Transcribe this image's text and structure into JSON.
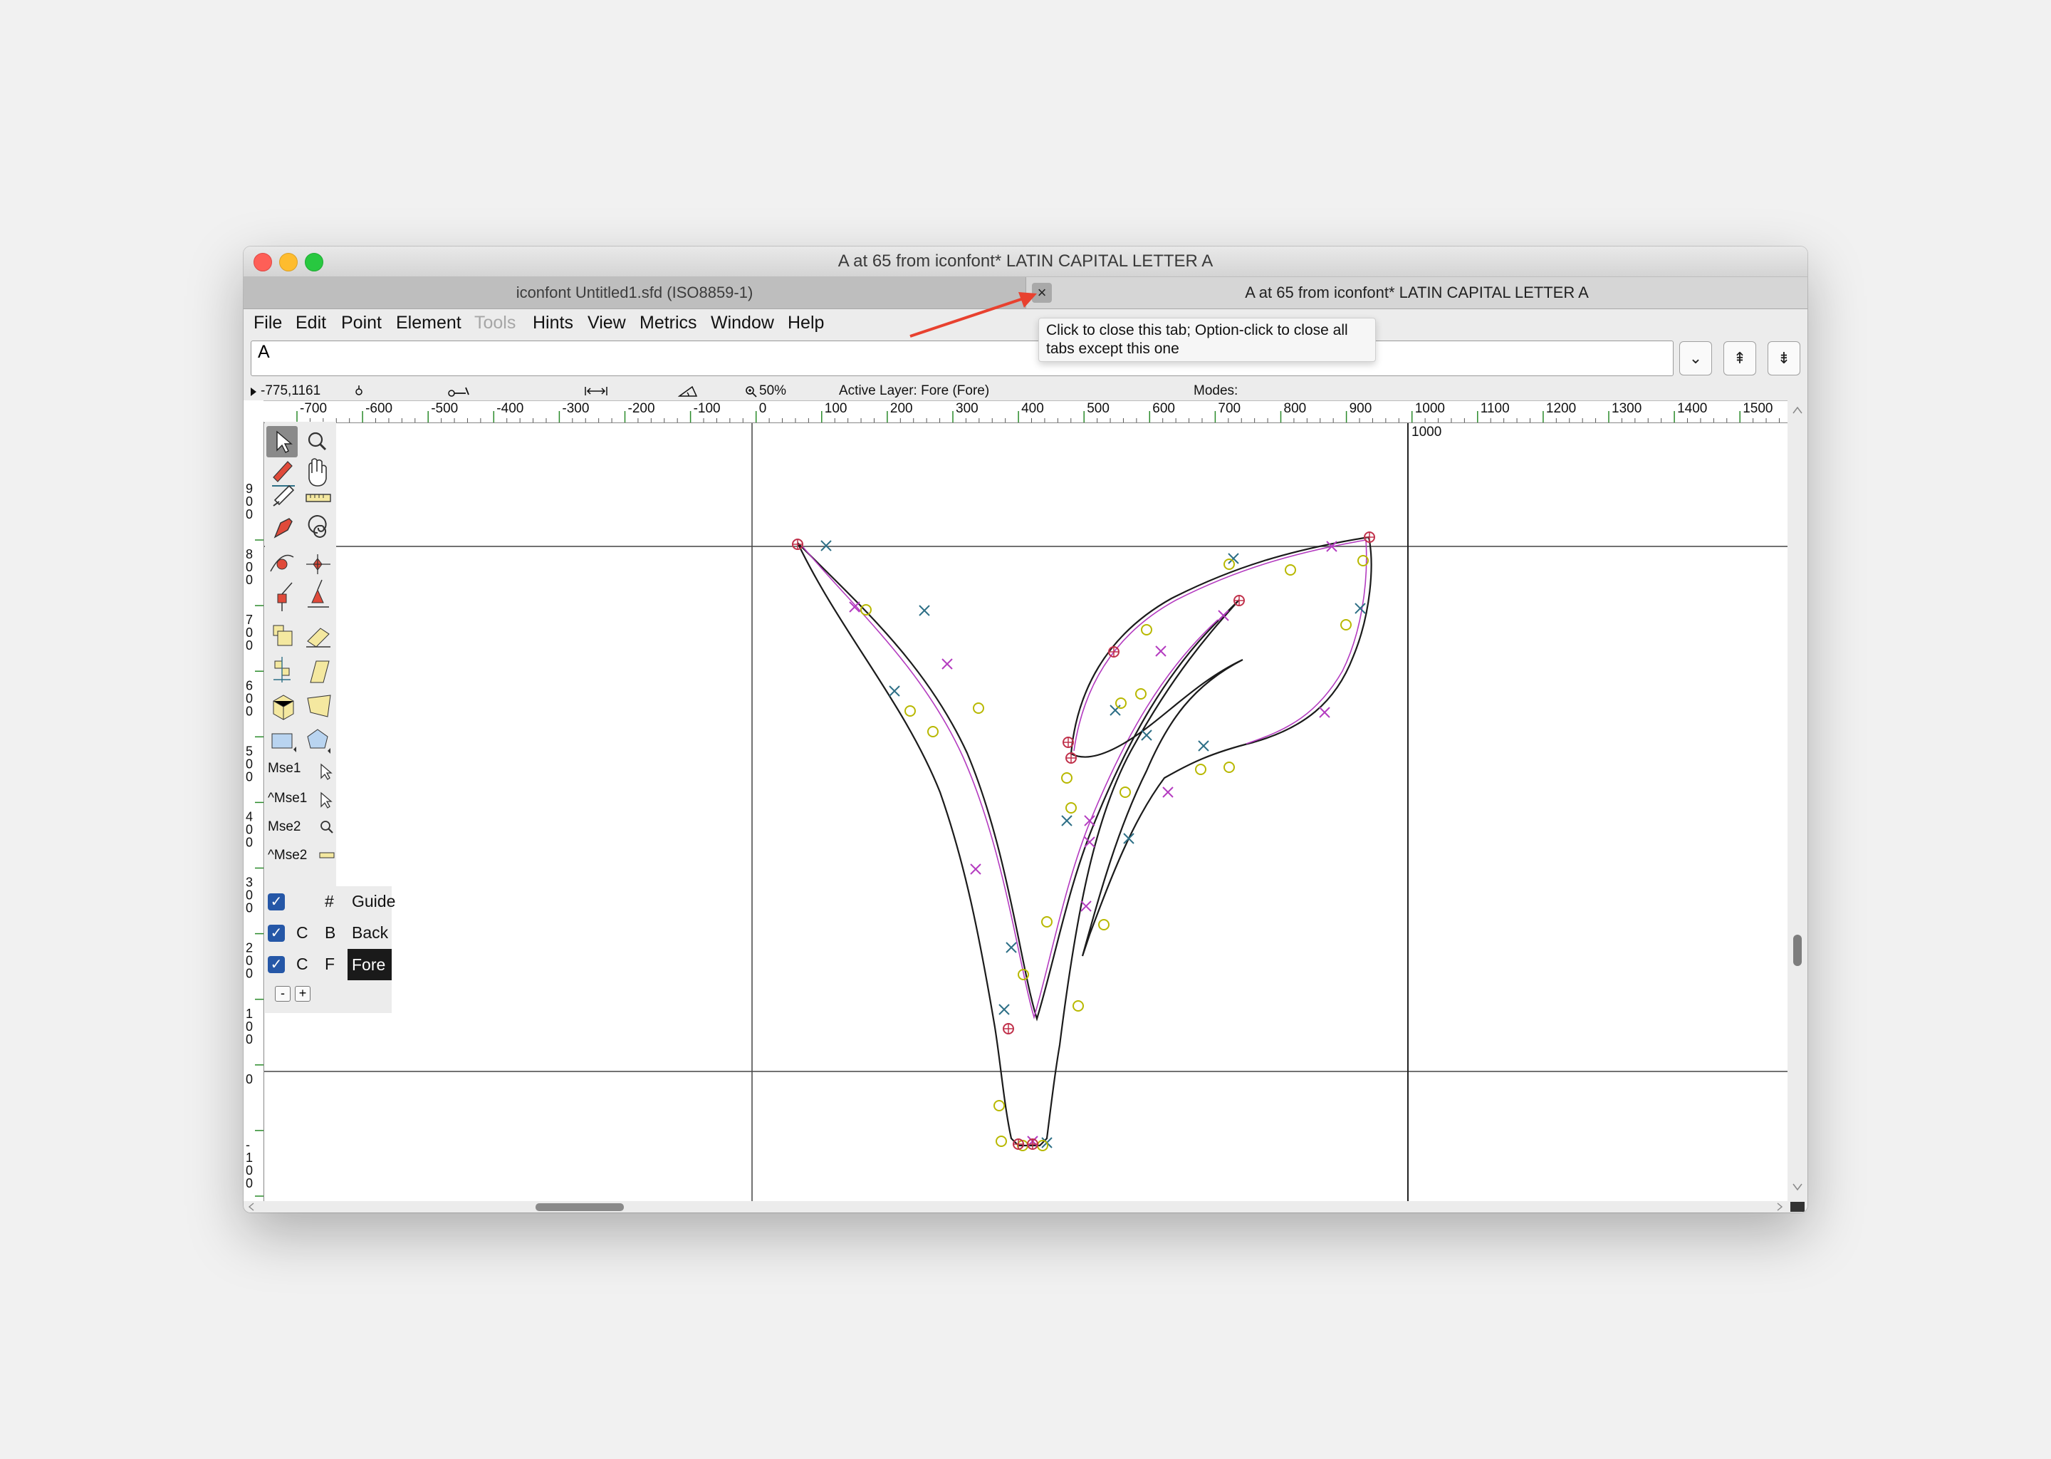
{
  "window": {
    "title": "A at 65 from iconfont* LATIN CAPITAL LETTER A",
    "traffic_lights": {
      "close": "#fe5f57",
      "minimize": "#febc2e",
      "zoom": "#28c840"
    }
  },
  "tabs": [
    {
      "label": "iconfont  Untitled1.sfd (ISO8859-1)"
    },
    {
      "label": "A at 65 from iconfont* LATIN CAPITAL LETTER A"
    }
  ],
  "tab_close": {
    "icon": "close-icon",
    "glyph": "×"
  },
  "tooltip": {
    "text": "Click to close this tab; Option-click to close all tabs except this one"
  },
  "menu": [
    "File",
    "Edit",
    "Point",
    "Element",
    "Tools",
    "Hints",
    "View",
    "Metrics",
    "Window",
    "Help"
  ],
  "glyph_field": {
    "value": "A"
  },
  "nav_buttons": [
    {
      "icon": "chevron-down-icon",
      "glyph": "⌄"
    },
    {
      "icon": "previous-glyph-icon",
      "glyph": "⇞"
    },
    {
      "icon": "next-glyph-icon",
      "glyph": "⇟"
    }
  ],
  "info": {
    "coords": "-775,1161",
    "zoom": "50%",
    "active_layer": "Active Layer: Fore (Fore)",
    "modes": "Modes:"
  },
  "ruler": {
    "h_labels": [
      "-700",
      "-600",
      "-500",
      "-400",
      "-300",
      "-200",
      "-100",
      "0",
      "100",
      "200",
      "300",
      "400",
      "500",
      "600",
      "700",
      "800",
      "900",
      "1000",
      "1100",
      "1200",
      "1300",
      "1400",
      "1500"
    ],
    "v_labels": [
      "900",
      "800",
      "700",
      "600",
      "500",
      "400",
      "300",
      "200",
      "100",
      "0",
      "-100"
    ],
    "advance_label": "1000"
  },
  "mouse_tools": [
    "Mse1",
    "^Mse1",
    "Mse2",
    "^Mse2"
  ],
  "layers": [
    {
      "c": "",
      "b": "#",
      "name": "Guide",
      "checked": true
    },
    {
      "c": "C",
      "b": "B",
      "name": "Back",
      "checked": true
    },
    {
      "c": "C",
      "b": "F",
      "name": "Fore",
      "checked": true,
      "active": true
    }
  ],
  "layer_buttons": [
    "-",
    "+"
  ],
  "colors": {
    "annotation_arrow": "#e8412f",
    "spline": "#1b1b1b",
    "control_point": "#b8b800",
    "on_curve": "#2d6f86",
    "off_curve": "#b43cc0",
    "ruler_green": "#2a8a2a"
  }
}
